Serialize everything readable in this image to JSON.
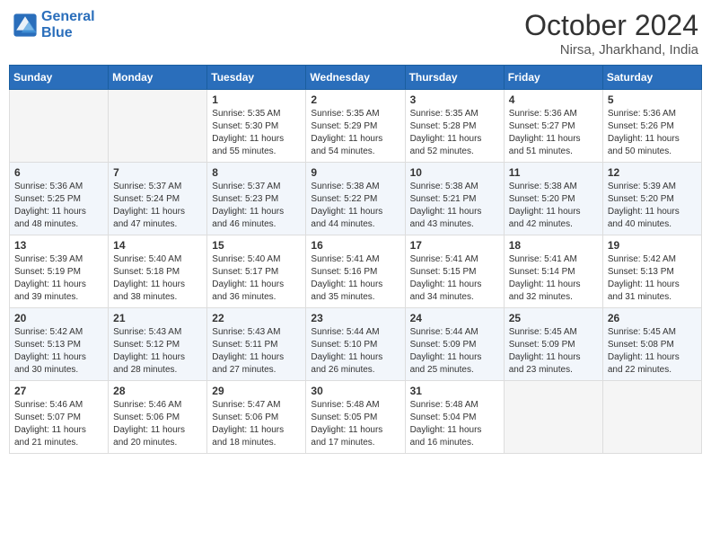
{
  "header": {
    "logo_line1": "General",
    "logo_line2": "Blue",
    "title": "October 2024",
    "subtitle": "Nirsa, Jharkhand, India"
  },
  "weekdays": [
    "Sunday",
    "Monday",
    "Tuesday",
    "Wednesday",
    "Thursday",
    "Friday",
    "Saturday"
  ],
  "weeks": [
    [
      {
        "day": "",
        "sunrise": "",
        "sunset": "",
        "daylight": ""
      },
      {
        "day": "",
        "sunrise": "",
        "sunset": "",
        "daylight": ""
      },
      {
        "day": "1",
        "sunrise": "Sunrise: 5:35 AM",
        "sunset": "Sunset: 5:30 PM",
        "daylight": "Daylight: 11 hours and 55 minutes."
      },
      {
        "day": "2",
        "sunrise": "Sunrise: 5:35 AM",
        "sunset": "Sunset: 5:29 PM",
        "daylight": "Daylight: 11 hours and 54 minutes."
      },
      {
        "day": "3",
        "sunrise": "Sunrise: 5:35 AM",
        "sunset": "Sunset: 5:28 PM",
        "daylight": "Daylight: 11 hours and 52 minutes."
      },
      {
        "day": "4",
        "sunrise": "Sunrise: 5:36 AM",
        "sunset": "Sunset: 5:27 PM",
        "daylight": "Daylight: 11 hours and 51 minutes."
      },
      {
        "day": "5",
        "sunrise": "Sunrise: 5:36 AM",
        "sunset": "Sunset: 5:26 PM",
        "daylight": "Daylight: 11 hours and 50 minutes."
      }
    ],
    [
      {
        "day": "6",
        "sunrise": "Sunrise: 5:36 AM",
        "sunset": "Sunset: 5:25 PM",
        "daylight": "Daylight: 11 hours and 48 minutes."
      },
      {
        "day": "7",
        "sunrise": "Sunrise: 5:37 AM",
        "sunset": "Sunset: 5:24 PM",
        "daylight": "Daylight: 11 hours and 47 minutes."
      },
      {
        "day": "8",
        "sunrise": "Sunrise: 5:37 AM",
        "sunset": "Sunset: 5:23 PM",
        "daylight": "Daylight: 11 hours and 46 minutes."
      },
      {
        "day": "9",
        "sunrise": "Sunrise: 5:38 AM",
        "sunset": "Sunset: 5:22 PM",
        "daylight": "Daylight: 11 hours and 44 minutes."
      },
      {
        "day": "10",
        "sunrise": "Sunrise: 5:38 AM",
        "sunset": "Sunset: 5:21 PM",
        "daylight": "Daylight: 11 hours and 43 minutes."
      },
      {
        "day": "11",
        "sunrise": "Sunrise: 5:38 AM",
        "sunset": "Sunset: 5:20 PM",
        "daylight": "Daylight: 11 hours and 42 minutes."
      },
      {
        "day": "12",
        "sunrise": "Sunrise: 5:39 AM",
        "sunset": "Sunset: 5:20 PM",
        "daylight": "Daylight: 11 hours and 40 minutes."
      }
    ],
    [
      {
        "day": "13",
        "sunrise": "Sunrise: 5:39 AM",
        "sunset": "Sunset: 5:19 PM",
        "daylight": "Daylight: 11 hours and 39 minutes."
      },
      {
        "day": "14",
        "sunrise": "Sunrise: 5:40 AM",
        "sunset": "Sunset: 5:18 PM",
        "daylight": "Daylight: 11 hours and 38 minutes."
      },
      {
        "day": "15",
        "sunrise": "Sunrise: 5:40 AM",
        "sunset": "Sunset: 5:17 PM",
        "daylight": "Daylight: 11 hours and 36 minutes."
      },
      {
        "day": "16",
        "sunrise": "Sunrise: 5:41 AM",
        "sunset": "Sunset: 5:16 PM",
        "daylight": "Daylight: 11 hours and 35 minutes."
      },
      {
        "day": "17",
        "sunrise": "Sunrise: 5:41 AM",
        "sunset": "Sunset: 5:15 PM",
        "daylight": "Daylight: 11 hours and 34 minutes."
      },
      {
        "day": "18",
        "sunrise": "Sunrise: 5:41 AM",
        "sunset": "Sunset: 5:14 PM",
        "daylight": "Daylight: 11 hours and 32 minutes."
      },
      {
        "day": "19",
        "sunrise": "Sunrise: 5:42 AM",
        "sunset": "Sunset: 5:13 PM",
        "daylight": "Daylight: 11 hours and 31 minutes."
      }
    ],
    [
      {
        "day": "20",
        "sunrise": "Sunrise: 5:42 AM",
        "sunset": "Sunset: 5:13 PM",
        "daylight": "Daylight: 11 hours and 30 minutes."
      },
      {
        "day": "21",
        "sunrise": "Sunrise: 5:43 AM",
        "sunset": "Sunset: 5:12 PM",
        "daylight": "Daylight: 11 hours and 28 minutes."
      },
      {
        "day": "22",
        "sunrise": "Sunrise: 5:43 AM",
        "sunset": "Sunset: 5:11 PM",
        "daylight": "Daylight: 11 hours and 27 minutes."
      },
      {
        "day": "23",
        "sunrise": "Sunrise: 5:44 AM",
        "sunset": "Sunset: 5:10 PM",
        "daylight": "Daylight: 11 hours and 26 minutes."
      },
      {
        "day": "24",
        "sunrise": "Sunrise: 5:44 AM",
        "sunset": "Sunset: 5:09 PM",
        "daylight": "Daylight: 11 hours and 25 minutes."
      },
      {
        "day": "25",
        "sunrise": "Sunrise: 5:45 AM",
        "sunset": "Sunset: 5:09 PM",
        "daylight": "Daylight: 11 hours and 23 minutes."
      },
      {
        "day": "26",
        "sunrise": "Sunrise: 5:45 AM",
        "sunset": "Sunset: 5:08 PM",
        "daylight": "Daylight: 11 hours and 22 minutes."
      }
    ],
    [
      {
        "day": "27",
        "sunrise": "Sunrise: 5:46 AM",
        "sunset": "Sunset: 5:07 PM",
        "daylight": "Daylight: 11 hours and 21 minutes."
      },
      {
        "day": "28",
        "sunrise": "Sunrise: 5:46 AM",
        "sunset": "Sunset: 5:06 PM",
        "daylight": "Daylight: 11 hours and 20 minutes."
      },
      {
        "day": "29",
        "sunrise": "Sunrise: 5:47 AM",
        "sunset": "Sunset: 5:06 PM",
        "daylight": "Daylight: 11 hours and 18 minutes."
      },
      {
        "day": "30",
        "sunrise": "Sunrise: 5:48 AM",
        "sunset": "Sunset: 5:05 PM",
        "daylight": "Daylight: 11 hours and 17 minutes."
      },
      {
        "day": "31",
        "sunrise": "Sunrise: 5:48 AM",
        "sunset": "Sunset: 5:04 PM",
        "daylight": "Daylight: 11 hours and 16 minutes."
      },
      {
        "day": "",
        "sunrise": "",
        "sunset": "",
        "daylight": ""
      },
      {
        "day": "",
        "sunrise": "",
        "sunset": "",
        "daylight": ""
      }
    ]
  ]
}
